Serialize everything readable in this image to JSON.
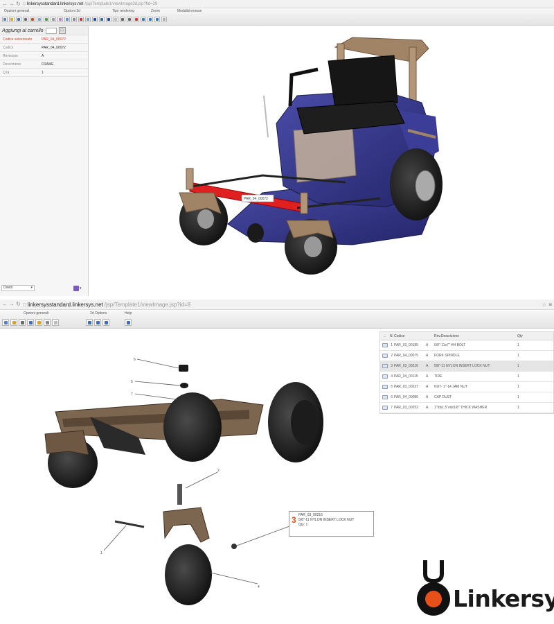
{
  "top_window": {
    "url_host": "linkersysstandard.linkersys.net",
    "url_path": "/jsp/Template1/viewImage3d.jsp?fid=29",
    "toolbar_groups": [
      "Opzioni generali",
      "Opzioni 3d",
      "Tipo rendering",
      "Zoom",
      "Modalità mouse"
    ],
    "cart_label": "Aggiungi al carrello",
    "properties": [
      {
        "key": "Codice selezionato",
        "value": "PAR_04_00072"
      },
      {
        "key": "Codice",
        "value": "PAR_04_00072"
      },
      {
        "key": "Revisione",
        "value": "A"
      },
      {
        "key": "Descrizione",
        "value": "FRAME"
      },
      {
        "key": "Q.tà",
        "value": "1"
      }
    ],
    "mode_select": "Diretti",
    "part_tag": "PAR_04_00072"
  },
  "bottom_window": {
    "url_host": "linkersysstandard.linkersys.net",
    "url_path": "/jsp/Template1/viewImage.jsp?id=8",
    "toolbar_groups": [
      "Opzioni generali",
      "2d Options",
      "Help"
    ],
    "table": {
      "headers": {
        "n": "N.",
        "codice": "Codice",
        "rev_desc": "Rev.Descrizione",
        "qty": "Qty"
      },
      "rows": [
        {
          "n": "1",
          "codice": "PAR_03_00185",
          "rev": "A",
          "desc": "5/8\"-11x7\" HH BOLT",
          "qty": "1"
        },
        {
          "n": "2",
          "codice": "PAR_04_00075",
          "rev": "A",
          "desc": "FORK SPINDLE",
          "qty": "1"
        },
        {
          "n": "3",
          "codice": "PAR_03_00216",
          "rev": "A",
          "desc": "5/8\"-11 NYLON INSERT LOCK NUT",
          "qty": "1"
        },
        {
          "n": "4",
          "codice": "PAR_04_00115",
          "rev": "A",
          "desc": "TIRE",
          "qty": "1"
        },
        {
          "n": "5",
          "codice": "PAR_03_00227",
          "rev": "A",
          "desc": "NUT- 1\"-14 JAM NUT",
          "qty": "1"
        },
        {
          "n": "6",
          "codice": "PAR_04_00080",
          "rev": "A",
          "desc": "CAP DUST",
          "qty": "1"
        },
        {
          "n": "7",
          "codice": "PAR_03_00252",
          "rev": "A",
          "desc": "1\"Idx1.5\"odx1/8\" THICK WASHER",
          "qty": "1"
        }
      ]
    },
    "callout": {
      "num": "3",
      "code": "PAR_03_00216",
      "desc": "5/8\"-11 NYLON INSERT LOCK NUT",
      "qty": "Qty: 1"
    },
    "labels": [
      "1",
      "2",
      "4",
      "5",
      "6",
      "7"
    ]
  },
  "brand": {
    "name": "Linkersys",
    "accent": "#e8501a",
    "selection_red": "#e03a2a",
    "frame_red": "#e02020",
    "body_blue": "#2e2f84"
  }
}
